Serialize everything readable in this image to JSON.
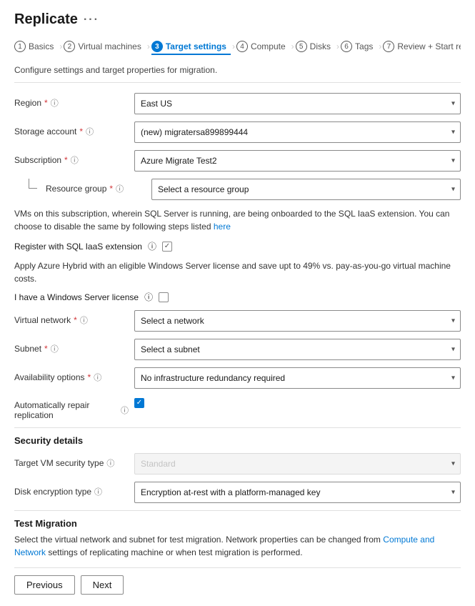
{
  "page": {
    "title": "Replicate",
    "ellipsis": "···"
  },
  "wizard": {
    "steps": [
      {
        "num": "1",
        "label": "Basics",
        "active": false
      },
      {
        "num": "2",
        "label": "Virtual machines",
        "active": false
      },
      {
        "num": "3",
        "label": "Target settings",
        "active": true
      },
      {
        "num": "4",
        "label": "Compute",
        "active": false
      },
      {
        "num": "5",
        "label": "Disks",
        "active": false
      },
      {
        "num": "6",
        "label": "Tags",
        "active": false
      },
      {
        "num": "7",
        "label": "Review + Start replication",
        "active": false
      }
    ]
  },
  "section_desc": "Configure settings and target properties for migration.",
  "fields": {
    "region": {
      "label": "Region",
      "required": true,
      "value": "East US"
    },
    "storage_account": {
      "label": "Storage account",
      "required": true,
      "value": "(new) migratersa899899444"
    },
    "subscription": {
      "label": "Subscription",
      "required": true,
      "value": "Azure Migrate Test2"
    },
    "resource_group": {
      "label": "Resource group",
      "required": true,
      "placeholder": "Select a resource group"
    },
    "sql_info": "VMs on this subscription, wherein SQL Server is running, are being onboarded to the SQL IaaS extension. You can choose to disable the same by following steps listed",
    "sql_link": "here",
    "register_sql_label": "Register with SQL IaaS extension",
    "hybrid_info": "Apply Azure Hybrid with an eligible Windows Server license and save upt to 49% vs. pay-as-you-go virtual machine costs.",
    "windows_license_label": "I have a Windows Server license",
    "virtual_network": {
      "label": "Virtual network",
      "required": true,
      "placeholder": "Select a network"
    },
    "subnet": {
      "label": "Subnet",
      "required": true,
      "placeholder": "Select a subnet"
    },
    "availability_options": {
      "label": "Availability options",
      "required": true,
      "value": "No infrastructure redundancy required"
    },
    "auto_repair_label": "Automatically repair replication",
    "auto_repair_checked": true
  },
  "security": {
    "header": "Security details",
    "target_vm_security": {
      "label": "Target VM security type",
      "placeholder": "Standard"
    },
    "disk_encryption": {
      "label": "Disk encryption type",
      "value": "Encryption at-rest with a platform-managed key"
    }
  },
  "test_migration": {
    "header": "Test Migration",
    "desc_part1": "Select the virtual network and subnet for test migration. Network properties can be changed from",
    "desc_link": "Compute and Network",
    "desc_part2": "settings of replicating machine or when test migration is performed."
  },
  "buttons": {
    "previous": "Previous",
    "next": "Next"
  },
  "icons": {
    "info": "ⓘ",
    "chevron_down": "▾"
  }
}
